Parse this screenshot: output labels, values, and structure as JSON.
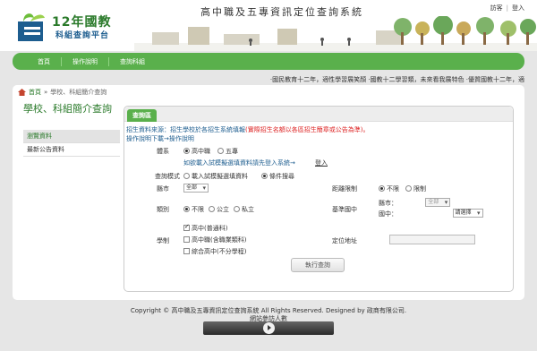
{
  "header": {
    "logo_title": "12年國教",
    "logo_subtitle": "科組查詢平台",
    "site_title": "高中職及五專資訊定位查詢系統",
    "links": {
      "visitor": "訪客",
      "separator": "|",
      "login": "登入"
    }
  },
  "nav": {
    "items": [
      "首頁",
      "操作說明",
      "查詢科組"
    ]
  },
  "marquee": "‧國民教育十二年，適性學習展笑顏 ‧國教十二學習類，未來看我展特色 ‧優質國教十二年，適",
  "breadcrumb": {
    "home": "首頁",
    "separator": "»",
    "section": "學校、科組簡介查詢"
  },
  "sidebar": {
    "title": "學校、科組簡介查詢",
    "items": [
      "瀏覽資料",
      "最新公告資料"
    ]
  },
  "panel": {
    "tab": "查詢區",
    "notice_prefix": "招生資料來源：招生學校於各招生系統填報",
    "notice_red": "(實際招生名額以各區招生簡章或公告為準)。",
    "manual_link": "操作說明下載→操作說明",
    "system": {
      "label": "體系",
      "options": [
        "高中職",
        "五專"
      ]
    },
    "import_link": "如欲載入試模擬選填資料請先登入系統→",
    "login_link": "登入",
    "mode": {
      "label": "查詢模式",
      "options": [
        "載入試模擬選填資料",
        "條件搜尋"
      ]
    },
    "county": {
      "label": "縣市",
      "value": "全部"
    },
    "distance": {
      "label": "距離限制",
      "options": [
        "不限",
        "限制"
      ]
    },
    "category": {
      "label": "類別",
      "options": [
        "不限",
        "公立",
        "私立"
      ]
    },
    "base_school": {
      "label": "基準國中",
      "county_label": "縣市：",
      "county_value": "全部",
      "school_label": "國中：",
      "school_value": "請選擇"
    },
    "system_type": {
      "label": "學制",
      "options": [
        "高中(普通科)",
        "高中職(含職業類科)",
        "綜合高中(不分學程)"
      ]
    },
    "location": {
      "label": "定位地址",
      "value": ""
    },
    "query_button": "執行查詢"
  },
  "footer": {
    "copyright": "Copyright © 高中職及五專資訊定位查詢系統 All Rights Reserved. Designed by 政商有限公司.",
    "visits": "網站參訪人數"
  },
  "colors": {
    "nav_green": "#5ab04c",
    "title_green": "#2a7a2a",
    "link_blue": "#1d5d8f",
    "notice_red": "#dd2222"
  }
}
